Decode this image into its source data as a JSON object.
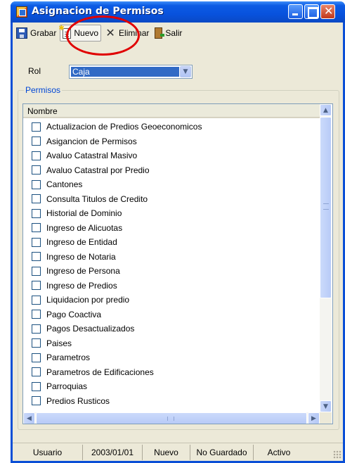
{
  "window": {
    "title": "Asignacion de Permisos"
  },
  "toolbar": {
    "save_label": "Grabar",
    "new_label": "Nuevo",
    "delete_label": "Eliminar",
    "exit_label": "Salir"
  },
  "form": {
    "rol_label": "Rol",
    "rol_value": "Caja"
  },
  "permisos": {
    "group_title": "Permisos",
    "column_header": "Nombre",
    "items": [
      "Actualizacion de Predios Geoeconomicos",
      "Asigancion de Permisos",
      "Avaluo Catastral Masivo",
      "Avaluo Catastral por Predio",
      "Cantones",
      "Consulta Titulos de Credito",
      "Historial de Dominio",
      "Ingreso de Alicuotas",
      "Ingreso de Entidad",
      "Ingreso de Notaria",
      "Ingreso de Persona",
      "Ingreso de Predios",
      "Liquidacion por predio",
      "Pago Coactiva",
      "Pagos Desactualizados",
      "Paises",
      "Parametros",
      "Parametros de Edificaciones",
      "Parroquias",
      "Predios Rusticos"
    ]
  },
  "status": {
    "user": "Usuario",
    "date": "2003/01/01",
    "mode": "Nuevo",
    "saved": "No Guardado",
    "state": "Activo"
  },
  "icons": {
    "app": "app-window-icon",
    "save": "floppy-disk-icon",
    "new": "new-document-icon",
    "delete": "x-delete-icon",
    "exit": "door-exit-icon"
  }
}
